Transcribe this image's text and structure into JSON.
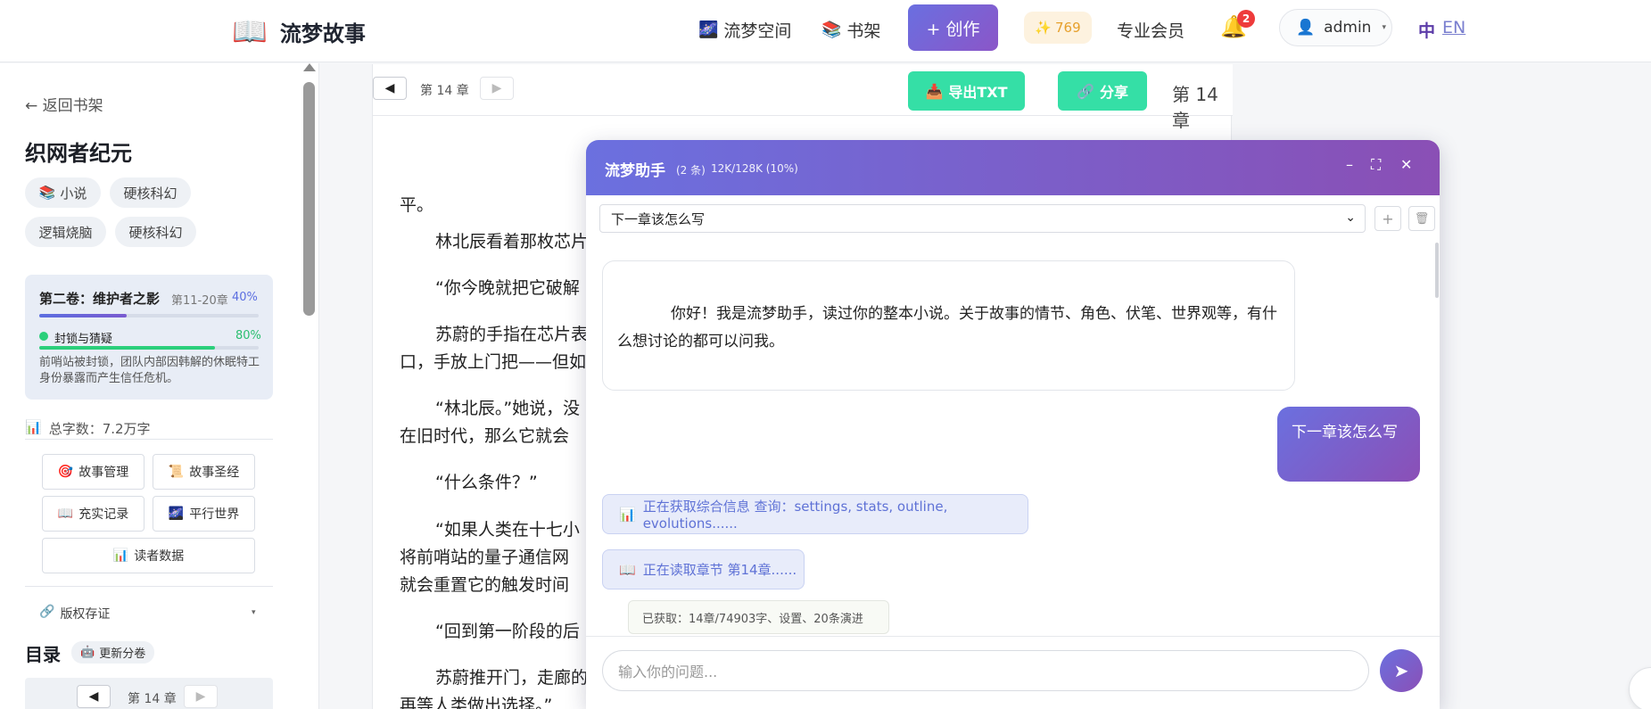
{
  "nav": {
    "logo_icon": "📖",
    "brand": "流梦故事",
    "links": [
      {
        "icon": "🌌",
        "label": "流梦空间"
      },
      {
        "icon": "📚",
        "label": "书架"
      }
    ],
    "create_label": "+ 创作",
    "points_icon": "✨",
    "points": "769",
    "vip_label": "专业会员",
    "notif_icon": "🔔",
    "notif_count": "2",
    "user_icon": "👤",
    "user_name": "admin",
    "user_caret": "▾",
    "lang_zh": "中",
    "lang_en": "EN"
  },
  "sidebar": {
    "back_label": "← 返回书架",
    "book_title": "织网者纪元",
    "tags": [
      {
        "icon": "📚",
        "label": "小说"
      },
      {
        "icon": "",
        "label": "硬核科幻"
      },
      {
        "icon": "",
        "label": "逻辑烧脑"
      },
      {
        "icon": "",
        "label": "硬核科幻"
      }
    ],
    "volume": {
      "title": "第二卷：维护者之影",
      "range": "第11-20章",
      "progress_pct": "40%",
      "progress": 0.4,
      "arc_title": "封锁与猜疑",
      "arc_pct": "80%",
      "arc_progress": 0.8,
      "arc_desc": "前哨站被封锁，团队内部因韩解的休眠特工身份暴露而产生信任危机。"
    },
    "word_count_icon": "📊",
    "word_count": "总字数：7.2万字",
    "buttons": [
      {
        "icon": "🎯",
        "label": "故事管理"
      },
      {
        "icon": "📜",
        "label": "故事圣经"
      },
      {
        "icon": "📖",
        "label": "充实记录"
      },
      {
        "icon": "🌌",
        "label": "平行世界"
      },
      {
        "icon": "📊",
        "label": "读者数据"
      }
    ],
    "copyright_icon": "🔗",
    "copyright_label": "版权存证",
    "toc_title": "目录",
    "toc_update_icon": "🤖",
    "toc_update_label": "更新分卷",
    "toc_prev": "◀",
    "toc_chapter": "第 14 章",
    "toc_next": "▶"
  },
  "reader": {
    "prev": "◀",
    "chapter_label": "第 14 章",
    "next": "▶",
    "export_icon": "📥",
    "export_label": "导出TXT",
    "share_icon": "🔗",
    "share_label": "分享",
    "chapter_right": "第 14 章",
    "paragraphs": [
      "平。",
      "林北辰看着那枚芯片",
      "“你今晚就把它破解",
      "苏蔚的手指在芯片表",
      "口，手放上门把——但如",
      "“林北辰。”她说，没",
      "在旧时代，那么它就会",
      "“什么条件？”",
      "“如果人类在十七小",
      "将前哨站的量子通信网",
      "就会重置它的触发时间",
      "“回到第一阶段的后",
      "苏蔚推开门，走廊的",
      "再等人类做出选择。”"
    ]
  },
  "chat": {
    "title": "流梦助手",
    "count": "(2 条)",
    "context": "12K/128K (10%)",
    "minimize_icon": "–",
    "expand_icon": "⛶",
    "close_icon": "✕",
    "selected_topic": "下一章该怎么写",
    "select_chevron": "⌄",
    "add_icon": "+",
    "delete_icon": "🗑",
    "bot_message": "你好！我是流梦助手，读过你的整本小说。关于故事的情节、角色、伏笔、世界观等，有什么想讨论的都可以问我。",
    "user_message": "下一章该怎么写",
    "tool_1_icon": "📊",
    "tool_1": "正在获取综合信息 查询：settings, stats, outline, evolutions......",
    "tool_2_icon": "📖",
    "tool_2": "正在读取章节 第14章......",
    "tool_result": "已获取：14章/74903字、设置、20条演进",
    "input_placeholder": "输入你的问题...",
    "send_icon": "➤"
  },
  "colors": {
    "accent_start": "#6b70df",
    "accent_end": "#8a4fb5",
    "green": "#35dfa6",
    "progress_blue": "#5b6ee0",
    "progress_green": "#2bcf7b"
  }
}
